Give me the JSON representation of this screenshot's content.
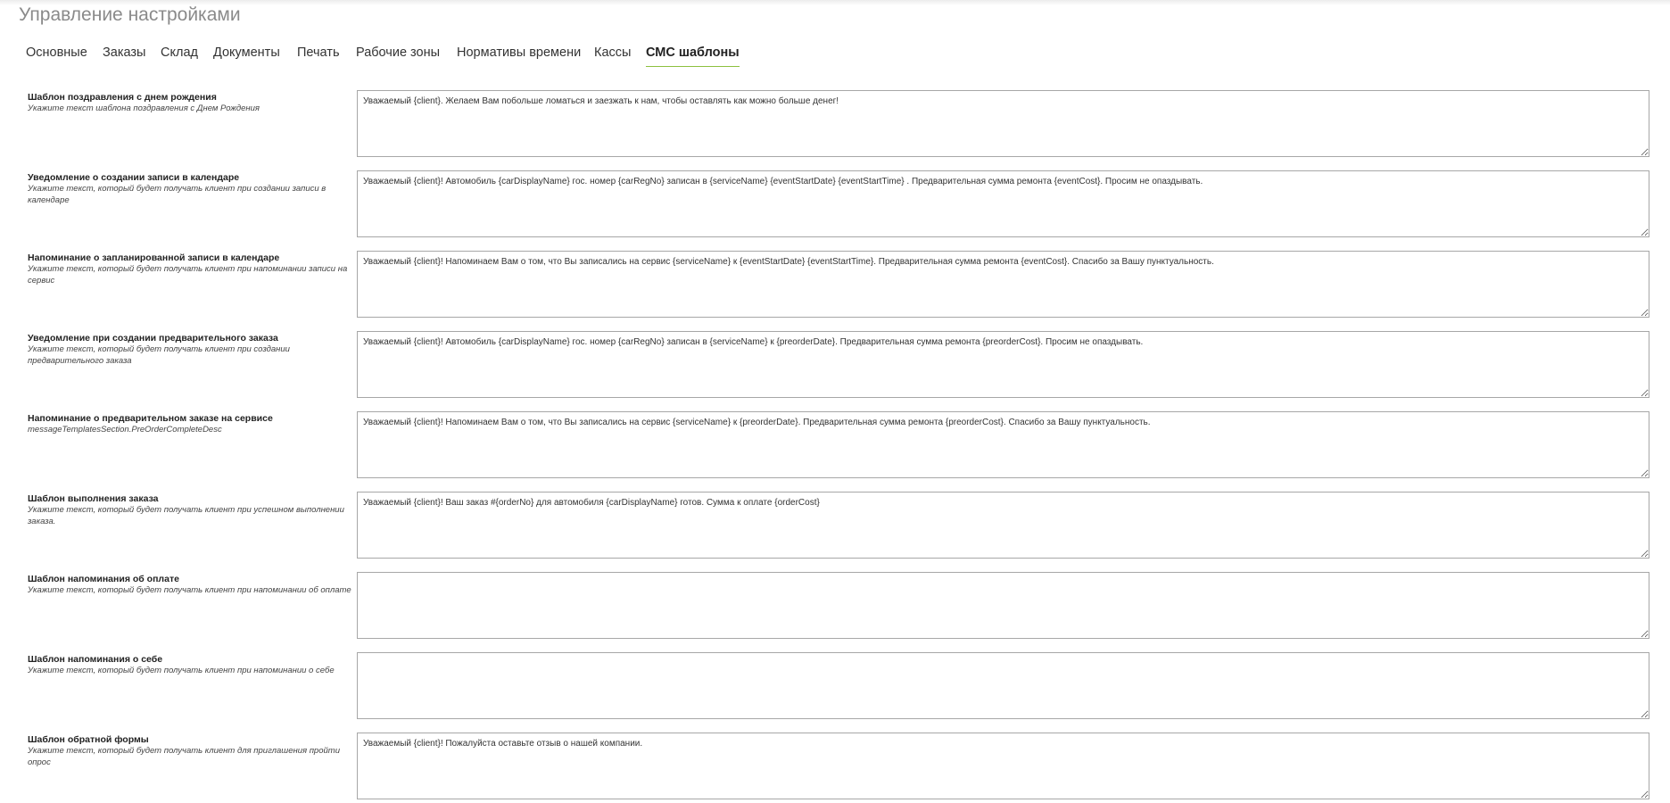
{
  "page": {
    "title": "Управление настройками"
  },
  "tabs": [
    {
      "label": "Основные"
    },
    {
      "label": "Заказы"
    },
    {
      "label": "Склад"
    },
    {
      "label": "Документы"
    },
    {
      "label": "Печать"
    },
    {
      "label": "Рабочие зоны"
    },
    {
      "label": "Нормативы времени"
    },
    {
      "label": "Кассы"
    },
    {
      "label": "СМС шаблоны",
      "active": true
    }
  ],
  "templates": [
    {
      "title": "Шаблон поздравления с днем рождения",
      "description": "Укажите текст шаблона поздравления с Днем Рождения",
      "value": "Уважаемый {client}. Желаем Вам побольше ломаться и заезжать к нам, чтобы оставлять как можно больше денег!"
    },
    {
      "title": "Уведомление о создании записи в календаре",
      "description": "Укажите текст, который будет получать клиент при создании записи в календаре",
      "value": "Уважаемый {client}! Автомобиль {carDisplayName} гос. номер {carRegNo} записан в {serviceName} {eventStartDate} {eventStartTime} . Предварительная сумма ремонта {eventCost}. Просим не опаздывать."
    },
    {
      "title": "Напоминание о запланированной записи в календаре",
      "description": "Укажите текст, который будет получать клиент при напоминании записи на сервис",
      "value": "Уважаемый {client}! Напоминаем Вам о том, что Вы записались на сервис {serviceName} к {eventStartDate} {eventStartTime}. Предварительная сумма ремонта {eventCost}. Спасибо за Вашу пунктуальность."
    },
    {
      "title": "Уведомление при создании предварительного заказа",
      "description": "Укажите текст, который будет получать клиент при создании предварительного заказа",
      "value": "Уважаемый {client}! Автомобиль {carDisplayName} гос. номер {carRegNo} записан в {serviceName} к {preorderDate}. Предварительная сумма ремонта {preorderCost}. Просим не опаздывать."
    },
    {
      "title": "Напоминание о предварительном заказе на сервисе",
      "description": "messageTemplatesSection.PreOrderCompleteDesc",
      "value": "Уважаемый {client}! Напоминаем Вам о том, что Вы записались на сервис {serviceName} к {preorderDate}. Предварительная сумма ремонта {preorderCost}. Спасибо за Вашу пунктуальность."
    },
    {
      "title": "Шаблон выполнения заказа",
      "description": "Укажите текст, который будет получать клиент при успешном выполнении заказа.",
      "value": "Уважаемый {client}! Ваш заказ #{orderNo} для автомобиля {carDisplayName} готов. Сумма к оплате {orderCost}"
    },
    {
      "title": "Шаблон напоминания об оплате",
      "description": "Укажите текст, который будет получать клиент при напоминании об оплате",
      "value": ""
    },
    {
      "title": "Шаблон напоминания о себе",
      "description": "Укажите текст, который будет получать клиент при напоминании о себе",
      "value": ""
    },
    {
      "title": "Шаблон обратной формы",
      "description": "Укажите текст, который будет получать клиент для приглашения пройти опрос",
      "value": "Уважаемый {client}! Пожалуйста оставьте отзыв о нашей компании."
    }
  ]
}
